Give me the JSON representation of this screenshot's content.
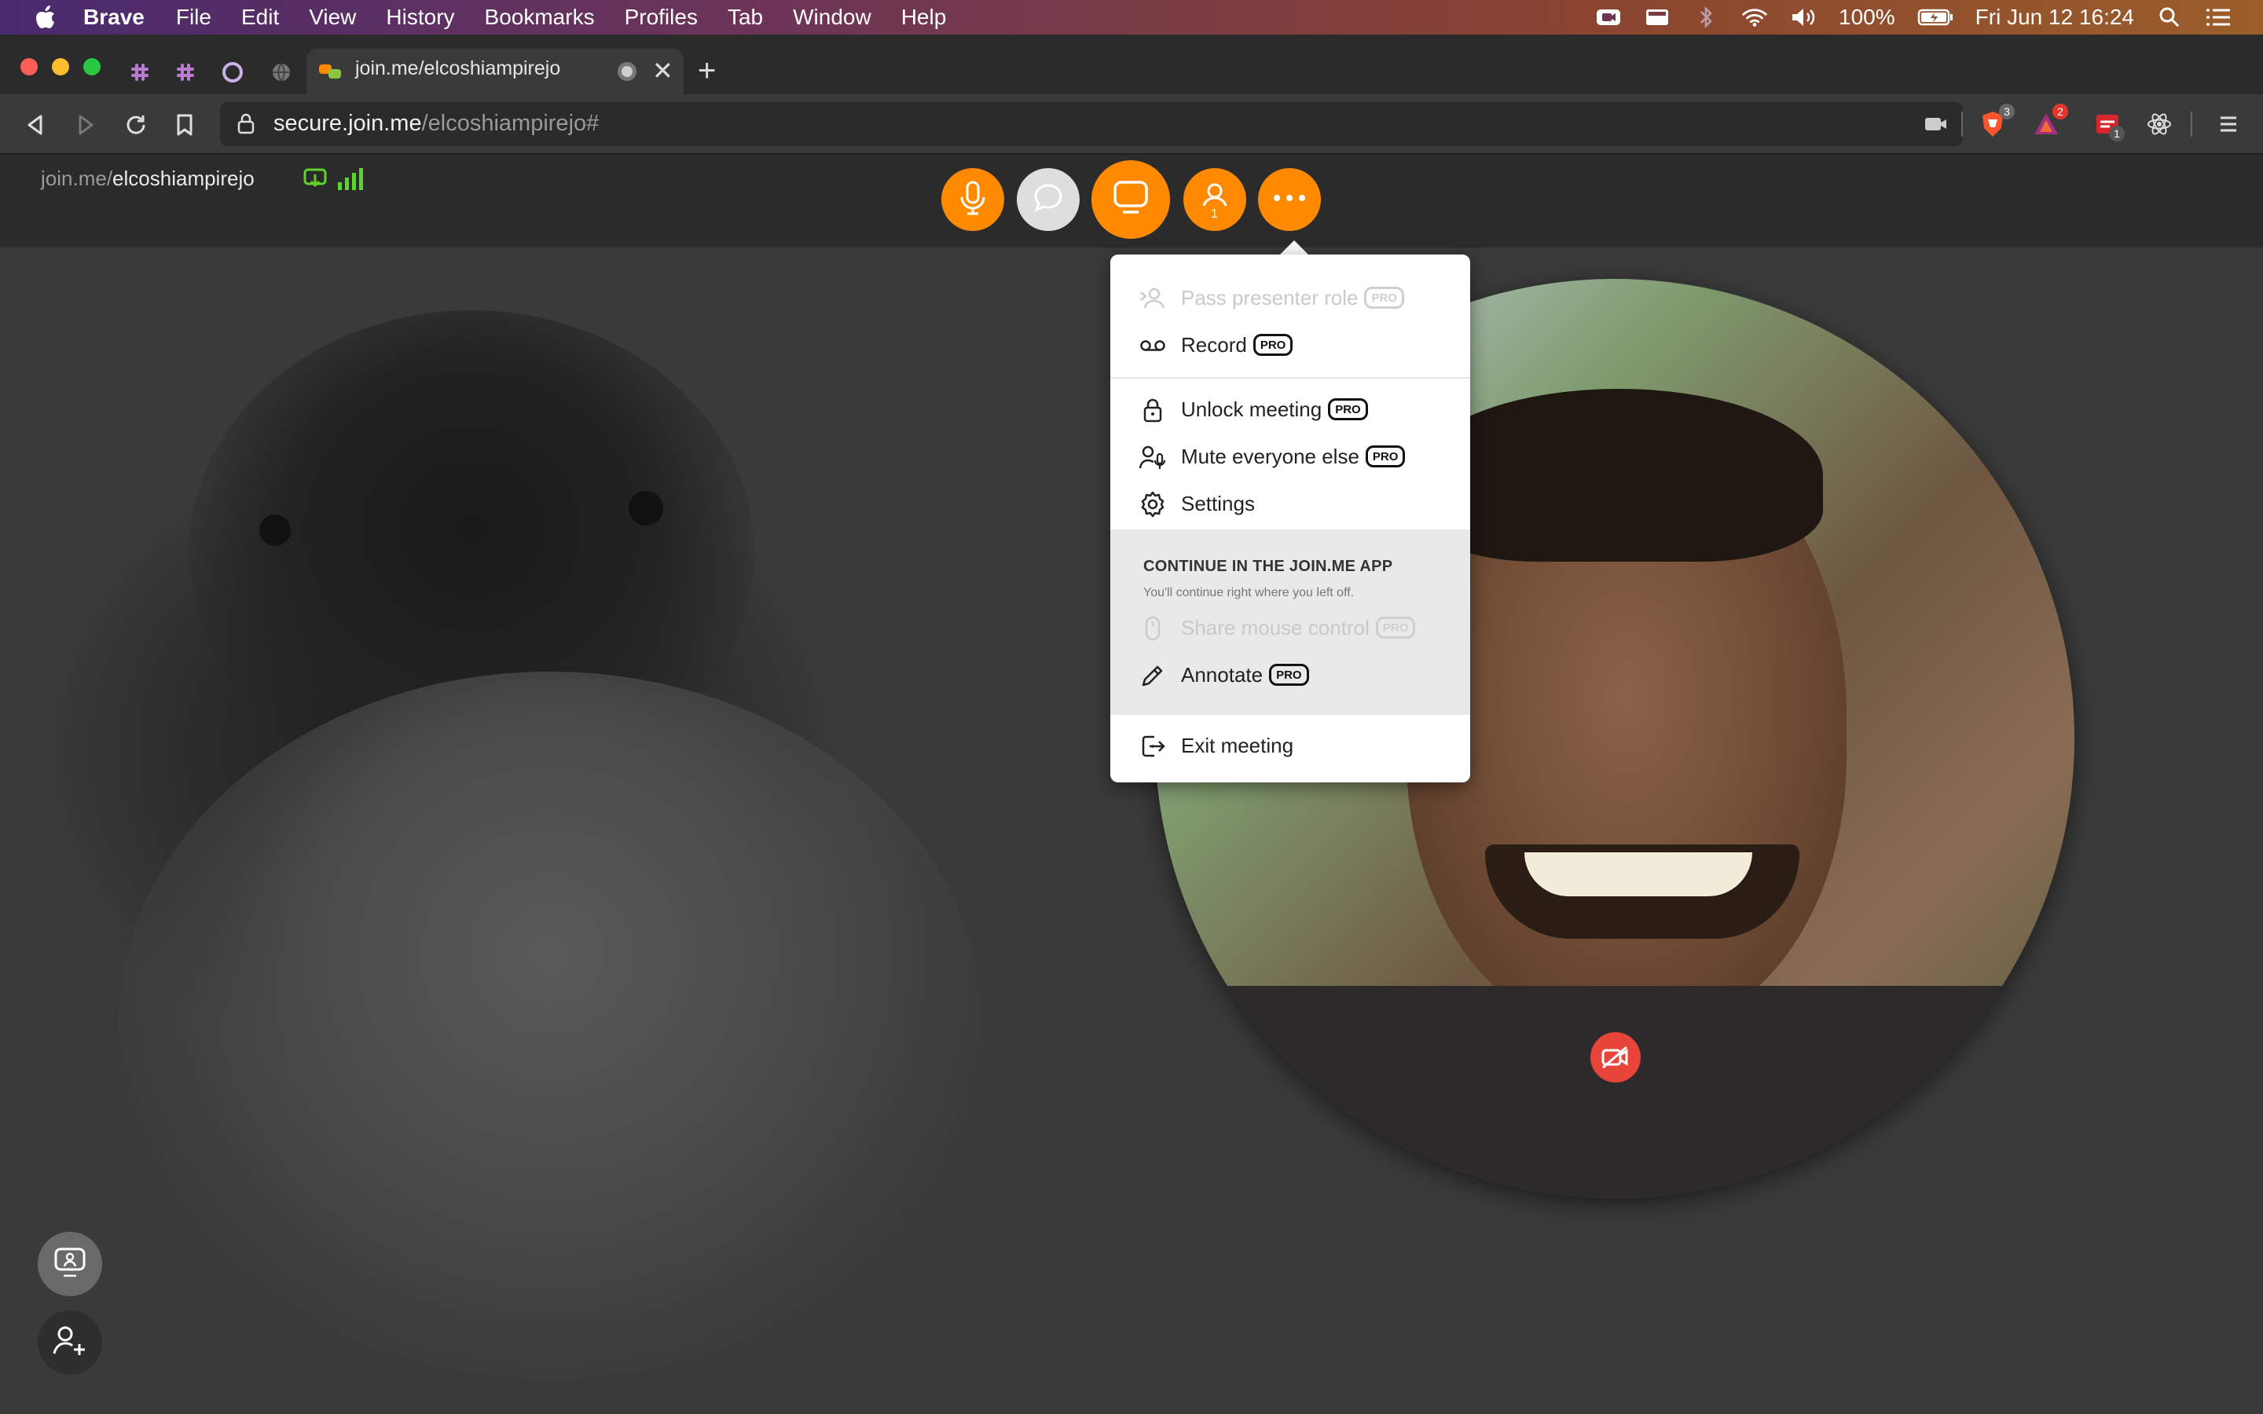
{
  "menubar": {
    "app_name": "Brave",
    "items": [
      "File",
      "Edit",
      "View",
      "History",
      "Bookmarks",
      "Profiles",
      "Tab",
      "Window",
      "Help"
    ],
    "battery": "100%",
    "clock": "Fri Jun 12  16:24"
  },
  "browser": {
    "tab_title": "join.me/elcoshiampirejo",
    "url_host": "secure.join.me",
    "url_path": "/elcoshiampirejo#",
    "extensions": {
      "brave_shields_count": "3",
      "rewards_count": "2",
      "ext3_count": "1"
    }
  },
  "joinme": {
    "url_prefix": "join.me/",
    "meeting_name": "elcoshiampirejo",
    "participants_count": "1",
    "accent_color": "#ff8a00"
  },
  "menu": {
    "items": [
      {
        "label": "Pass presenter role",
        "pro": "PRO",
        "disabled": true
      },
      {
        "label": "Record",
        "pro": "PRO"
      },
      {
        "label": "Unlock meeting",
        "pro": "PRO"
      },
      {
        "label": "Mute everyone else",
        "pro": "PRO"
      },
      {
        "label": "Settings"
      },
      {
        "label": "Share mouse control",
        "pro": "PRO",
        "disabled": true
      },
      {
        "label": "Annotate",
        "pro": "PRO"
      },
      {
        "label": "Exit meeting"
      }
    ],
    "app_section_title": "CONTINUE IN THE JOIN.ME APP",
    "app_section_subtitle": "You'll continue right where you left off."
  },
  "icons": [
    "apple-icon",
    "search-icon",
    "mic-icon",
    "chat-icon",
    "screen-share-icon",
    "participants-icon",
    "more-icon",
    "camera-off-icon",
    "add-person-icon"
  ]
}
